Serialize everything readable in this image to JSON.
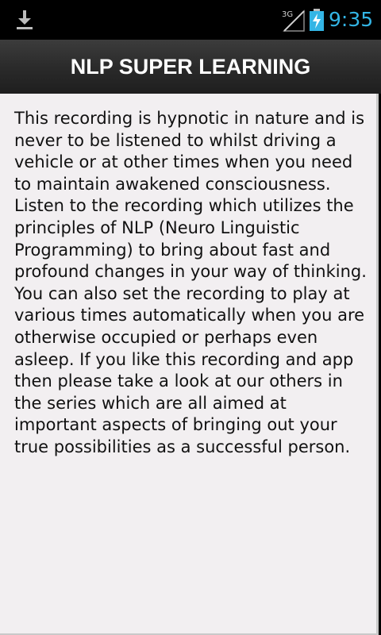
{
  "status_bar": {
    "network": "3G",
    "time": "9:35",
    "icons": [
      "download-icon",
      "signal-icon",
      "battery-charging-icon"
    ],
    "clock_color": "#33b5e5"
  },
  "app": {
    "title": "NLP SUPER LEARNING"
  },
  "content": {
    "text": "This recording is hypnotic in nature and is never to be listened to whilst driving a vehicle or at other times when you need to maintain awakened consciousness. Listen to the recording which utilizes the principles of NLP (Neuro Linguistic Programming) to bring about fast and profound changes in your way of thinking. You can also set the recording to play at various times automatically when you are otherwise occupied or perhaps even asleep. If you like this recording and app then please take a look at our others in the series which are all aimed at important aspects of bringing out your true possibilities as a successful person."
  }
}
